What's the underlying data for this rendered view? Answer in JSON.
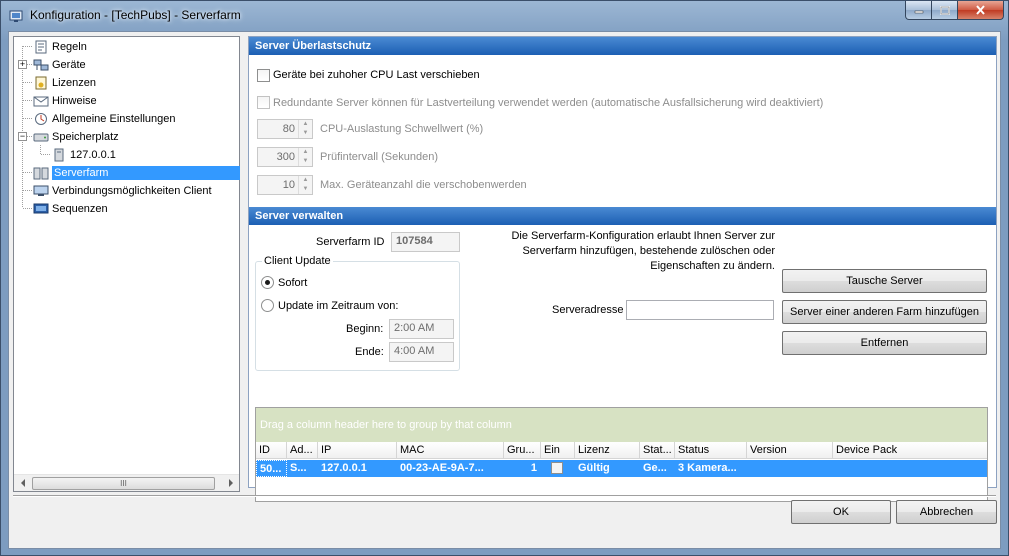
{
  "window": {
    "title": "Konfiguration - [TechPubs] - Serverfarm"
  },
  "tree": {
    "items": [
      {
        "label": "Regeln",
        "icon": "rules-icon"
      },
      {
        "label": "Geräte",
        "icon": "devices-icon"
      },
      {
        "label": "Lizenzen",
        "icon": "license-icon"
      },
      {
        "label": "Hinweise",
        "icon": "notice-icon"
      },
      {
        "label": "Allgemeine Einstellungen",
        "icon": "settings-icon"
      },
      {
        "label": "Speicherplatz",
        "icon": "storage-icon"
      },
      {
        "label": "127.0.0.1",
        "icon": "server-icon"
      },
      {
        "label": "Serverfarm",
        "icon": "server-farm-icon"
      },
      {
        "label": "Verbindungsmöglichkeiten Client",
        "icon": "connection-icon"
      },
      {
        "label": "Sequenzen",
        "icon": "sequences-icon"
      }
    ],
    "scroll_grip": "III"
  },
  "overload": {
    "header": "Server Überlastschutz",
    "move_devices_label": "Geräte bei zuhoher CPU Last verschieben",
    "redundant_label": "Redundante Server können für Lastverteilung verwendet werden (automatische Ausfallsicherung wird deaktiviert)",
    "cpu_threshold_value": "80",
    "cpu_threshold_label": "CPU-Auslastung Schwellwert (%)",
    "interval_value": "300",
    "interval_label": "Prüfintervall (Sekunden)",
    "max_devices_value": "10",
    "max_devices_label": "Max. Geräteanzahl die verschobenwerden"
  },
  "manage": {
    "header": "Server verwalten",
    "farm_id_label": "Serverfarm ID",
    "farm_id_value": "107584",
    "client_update_legend": "Client Update",
    "immediate_label": "Sofort",
    "timeframe_label": "Update im Zeitraum von:",
    "begin_label": "Beginn:",
    "begin_value": "2:00 AM",
    "end_label": "Ende:",
    "end_value": "4:00 AM",
    "info_line1": "Die Serverfarm-Konfiguration erlaubt Ihnen Server zur",
    "info_line2": "Serverfarm hinzufügen, bestehende zulöschen oder",
    "info_line3": "Eigenschaften zu ändern.",
    "swap_button": "Tausche Server",
    "address_label": "Serveradresse",
    "address_value": "",
    "add_other_farm_button": "Server einer anderen Farm hinzufügen",
    "remove_button": "Entfernen"
  },
  "grid": {
    "group_hint": "Drag a column header here to group by that column",
    "columns": [
      "ID",
      "Ad...",
      "IP",
      "MAC",
      "Gru...",
      "Ein",
      "Lizenz",
      "Stat...",
      "Status",
      "Version",
      "Device Pack"
    ],
    "rows": [
      {
        "id": "50...",
        "ad": "S...",
        "ip": "127.0.0.1",
        "mac": "00-23-AE-9A-7...",
        "gru": "1",
        "ein": "",
        "lizenz": "Gültig",
        "stat": "Ge...",
        "status": "3 Kamera...",
        "version": "",
        "device_pack": ""
      }
    ]
  },
  "footer": {
    "ok_button": "OK",
    "cancel_button": "Abbrechen"
  }
}
